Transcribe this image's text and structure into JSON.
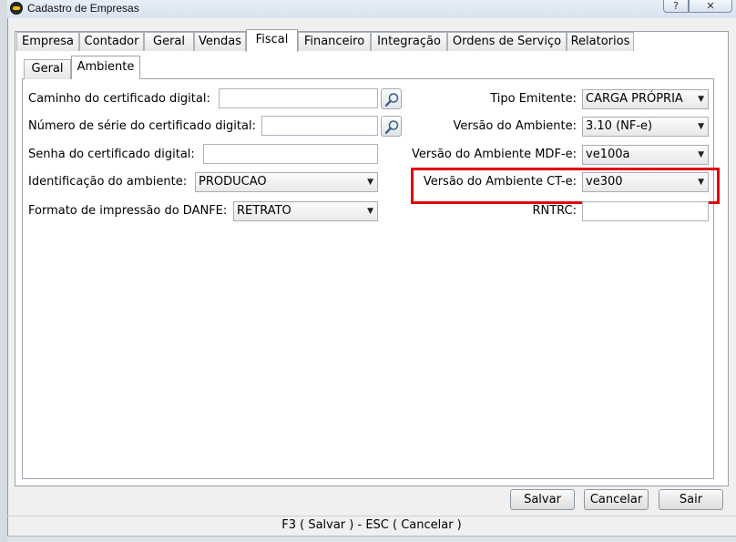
{
  "window": {
    "title": "Cadastro de Empresas",
    "help_label": "?",
    "close_label": "✕"
  },
  "tabs": [
    {
      "label": "Empresa"
    },
    {
      "label": "Contador"
    },
    {
      "label": "Geral"
    },
    {
      "label": "Vendas"
    },
    {
      "label": "Fiscal",
      "active": true
    },
    {
      "label": "Financeiro"
    },
    {
      "label": "Integração"
    },
    {
      "label": "Ordens de Serviço"
    },
    {
      "label": "Relatorios"
    }
  ],
  "subtabs": [
    {
      "label": "Geral"
    },
    {
      "label": "Ambiente",
      "active": true
    }
  ],
  "form_left": {
    "certificate_path": {
      "label": "Caminho do certificado digital:",
      "value": ""
    },
    "certificate_serial": {
      "label": "Número de série do certificado digital:",
      "value": ""
    },
    "certificate_password": {
      "label": "Senha do certificado digital:",
      "value": ""
    },
    "environment_id": {
      "label": "Identificação do ambiente:",
      "value": "PRODUCAO"
    },
    "danfe_format": {
      "label": "Formato de impressão do DANFE:",
      "value": "RETRATO"
    }
  },
  "form_right": {
    "issuer_type": {
      "label": "Tipo Emitente:",
      "value": "CARGA PRÓPRIA"
    },
    "env_version": {
      "label": "Versão do Ambiente:",
      "value": "3.10 (NF-e)"
    },
    "env_version_mdfe": {
      "label": "Versão do Ambiente MDF-e:",
      "value": "ve100a"
    },
    "env_version_cte": {
      "label": "Versão do Ambiente CT-e:",
      "value": "ve300"
    },
    "rntrc": {
      "label": "RNTRC:",
      "value": ""
    }
  },
  "buttons": {
    "save": "Salvar",
    "cancel": "Cancelar",
    "exit": "Sair"
  },
  "status_bar": "F3 ( Salvar )  -  ESC ( Cancelar )",
  "colors": {
    "highlight": "#e00000",
    "window_bg": "#f0f0f0"
  },
  "icons": {
    "search": "magnifier-icon",
    "dropdown": "chevron-down-icon"
  }
}
